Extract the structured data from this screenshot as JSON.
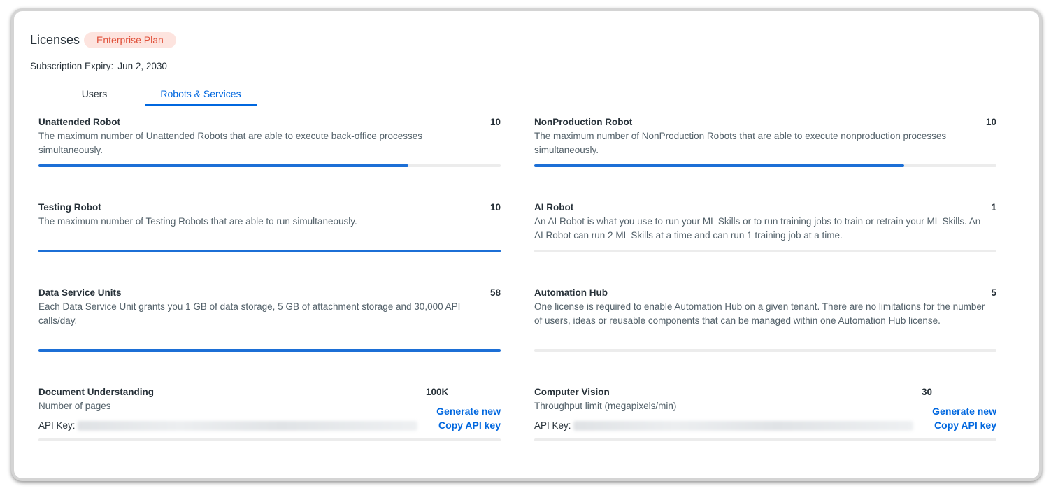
{
  "header": {
    "title": "Licenses",
    "plan_badge": "Enterprise Plan",
    "expiry_label": "Subscription Expiry:",
    "expiry_value": "Jun 2, 2030"
  },
  "tabs": [
    {
      "label": "Users",
      "selected": false
    },
    {
      "label": "Robots & Services",
      "selected": true
    }
  ],
  "licenses": {
    "unattended": {
      "name": "Unattended Robot",
      "count": "10",
      "description": "The maximum number of Unattended Robots that are able to execute back-office processes simultaneously.",
      "usage_fraction": 0.8
    },
    "nonproduction": {
      "name": "NonProduction Robot",
      "count": "10",
      "description": "The maximum number of NonProduction Robots that are able to execute nonproduction processes simultaneously.",
      "usage_fraction": 0.8
    },
    "testing": {
      "name": "Testing Robot",
      "count": "10",
      "description": "The maximum number of Testing Robots that are able to run simultaneously.",
      "usage_fraction": 1.0
    },
    "ai": {
      "name": "AI Robot",
      "count": "1",
      "description": "An AI Robot is what you use to run your ML Skills or to run training jobs to train or retrain your ML Skills. An AI Robot can run 2 ML Skills at a time and can run 1 training job at a time.",
      "usage_fraction": 0
    },
    "data_service": {
      "name": "Data Service Units",
      "count": "58",
      "description": "Each Data Service Unit grants you 1 GB of data storage, 5 GB of attachment storage and 30,000 API calls/day.",
      "usage_fraction": 1.0
    },
    "automation_hub": {
      "name": "Automation Hub",
      "count": "5",
      "description": "One license is required to enable Automation Hub on a given tenant. There are no limitations for the number of users, ideas or reusable components that can be managed within one Automation Hub license.",
      "usage_fraction": 0
    },
    "document_understanding": {
      "name": "Document Understanding",
      "count": "100K",
      "description": "Number of pages",
      "api_key_label": "API Key:",
      "generate_label": "Generate new",
      "copy_label": "Copy API key",
      "usage_fraction": 0
    },
    "computer_vision": {
      "name": "Computer Vision",
      "count": "30",
      "description": "Throughput limit (megapixels/min)",
      "api_key_label": "API Key:",
      "generate_label": "Generate new",
      "copy_label": "Copy API key",
      "usage_fraction": 0
    }
  },
  "colors": {
    "accent": "#0067df",
    "bar_fill": "#1c6fd6",
    "bar_track": "#ececec",
    "badge_bg": "#fde4df",
    "badge_text": "#e0513b"
  }
}
